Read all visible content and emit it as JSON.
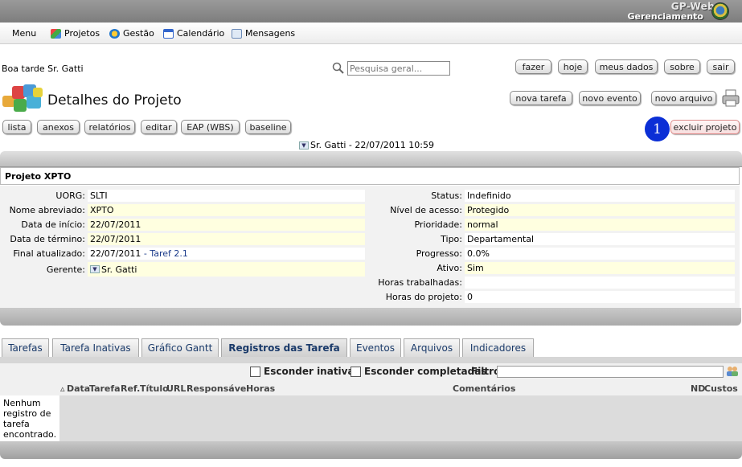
{
  "header": {
    "brand_line1": "GP-Web",
    "brand_line2": "Gerenciamento"
  },
  "menu": [
    {
      "label": "Menu"
    },
    {
      "label": "Projetos"
    },
    {
      "label": "Gestão"
    },
    {
      "label": "Calendário"
    },
    {
      "label": "Mensagens"
    }
  ],
  "greeting": "Boa tarde Sr. Gatti",
  "search": {
    "placeholder": "Pesquisa geral..."
  },
  "top_buttons": [
    "fazer",
    "hoje",
    "meus dados",
    "sobre",
    "sair"
  ],
  "page_title": "Detalhes do Projeto",
  "create_buttons": [
    "nova tarefa",
    "novo evento",
    "novo arquivo"
  ],
  "action_buttons": [
    "lista",
    "anexos",
    "relatórios",
    "editar",
    "EAP (WBS)",
    "baseline"
  ],
  "delete": {
    "badge": "1",
    "label": "excluir projeto"
  },
  "owner_line": "Sr. Gatti - 22/07/2011 10:59",
  "project": {
    "name": "Projeto XPTO",
    "left": [
      {
        "label": "UORG:",
        "value": "SLTI"
      },
      {
        "label": "Nome abreviado:",
        "value": "XPTO"
      },
      {
        "label": "Data de início:",
        "value": "22/07/2011"
      },
      {
        "label": "Data de término:",
        "value": "22/07/2011"
      },
      {
        "label": "Final atualizado:",
        "value": "22/07/2011",
        "link": "- Taref 2.1"
      },
      {
        "label": "Gerente:",
        "value": "Sr. Gatti"
      }
    ],
    "right": [
      {
        "label": "Status:",
        "value": "Indefinido"
      },
      {
        "label": "Nível de acesso:",
        "value": "Protegido"
      },
      {
        "label": "Prioridade:",
        "value": "normal"
      },
      {
        "label": "Tipo:",
        "value": "Departamental"
      },
      {
        "label": "Progresso:",
        "value": "0.0%"
      },
      {
        "label": "Ativo:",
        "value": "Sim"
      },
      {
        "label": "Horas trabalhadas:",
        "value": ""
      },
      {
        "label": "Horas do projeto:",
        "value": "0"
      }
    ]
  },
  "tabs": [
    "Tarefas",
    "Tarefa Inativas",
    "Gráfico Gantt",
    "Registros das Tarefa",
    "Eventos",
    "Arquivos",
    "Indicadores"
  ],
  "active_tab": "Registros das Tarefa",
  "filters": {
    "hide_inactive": "Esconder inativas",
    "hide_completed": "Esconder completadas",
    "filter_label": "Filtro"
  },
  "columns": [
    "Data",
    "Tarefa",
    "Ref.",
    "Título",
    "URL",
    "Responsável",
    "Horas",
    "Comentários",
    "ND",
    "Custos"
  ],
  "empty_message": "Nenhum registro de tarefa encontrado.",
  "colors": {
    "delete_badge": "#0b2fd6",
    "highlight_row": "#ffffe0",
    "tab_text": "#1a3a6a"
  }
}
